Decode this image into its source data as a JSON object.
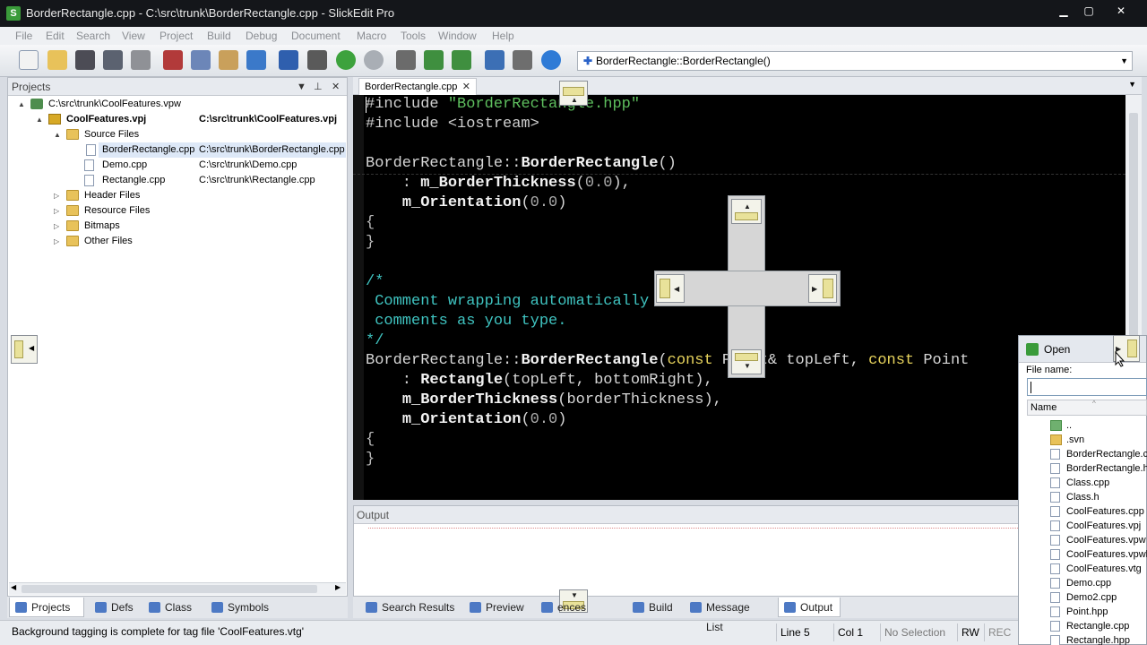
{
  "window": {
    "title": "BorderRectangle.cpp - C:\\src\\trunk\\BorderRectangle.cpp - SlickEdit Pro",
    "app_icon": "slickedit-icon",
    "controls": [
      "minimize",
      "maximize",
      "close"
    ]
  },
  "menu": [
    "File",
    "Edit",
    "Search",
    "View",
    "Project",
    "Build",
    "Debug",
    "Document",
    "Macro",
    "Tools",
    "Window",
    "Help"
  ],
  "toolbar": {
    "buttons": [
      "new",
      "open",
      "save",
      "save-all",
      "print",
      "cut",
      "copy",
      "paste",
      "select",
      "undo",
      "redo",
      "back",
      "forward",
      "find",
      "find-next",
      "find-in-files",
      "project",
      "options",
      "help"
    ],
    "symbol_combo": "BorderRectangle::BorderRectangle()"
  },
  "projects_panel": {
    "title": "Projects",
    "tree": [
      {
        "label": "C:\\src\\trunk\\CoolFeatures.vpw",
        "path": "",
        "level": 0,
        "icon": "workspace",
        "expander": "▲"
      },
      {
        "label": "CoolFeatures.vpj",
        "path": "C:\\src\\trunk\\CoolFeatures.vpj",
        "level": 1,
        "icon": "project",
        "expander": "▲",
        "bold": true
      },
      {
        "label": "Source Files",
        "path": "",
        "level": 2,
        "icon": "folder",
        "expander": "▲"
      },
      {
        "label": "BorderRectangle.cpp",
        "path": "C:\\src\\trunk\\BorderRectangle.cpp",
        "level": 3,
        "icon": "file",
        "expander": "",
        "selected": true
      },
      {
        "label": "Demo.cpp",
        "path": "C:\\src\\trunk\\Demo.cpp",
        "level": 3,
        "icon": "file",
        "expander": ""
      },
      {
        "label": "Rectangle.cpp",
        "path": "C:\\src\\trunk\\Rectangle.cpp",
        "level": 3,
        "icon": "file",
        "expander": ""
      },
      {
        "label": "Header Files",
        "path": "",
        "level": 2,
        "icon": "folder",
        "expander": "▷"
      },
      {
        "label": "Resource Files",
        "path": "",
        "level": 2,
        "icon": "folder",
        "expander": "▷"
      },
      {
        "label": "Bitmaps",
        "path": "",
        "level": 2,
        "icon": "folder",
        "expander": "▷"
      },
      {
        "label": "Other Files",
        "path": "",
        "level": 2,
        "icon": "folder",
        "expander": "▷"
      }
    ],
    "tabs": [
      "Projects",
      "Defs",
      "Class",
      "Symbols"
    ],
    "active_tab": "Projects"
  },
  "editor": {
    "tab": "BorderRectangle.cpp",
    "lines": [
      [
        {
          "t": "#include ",
          "c": "pp"
        },
        {
          "t": "\"BorderRectangle.hpp\"",
          "c": "str"
        }
      ],
      [
        {
          "t": "#include <iostream>",
          "c": "pp"
        }
      ],
      [],
      [
        {
          "t": "BorderRectangle",
          "c": ""
        },
        {
          "t": "::",
          "c": ""
        },
        {
          "t": "BorderRectangle",
          "c": "bold"
        },
        {
          "t": "()",
          "c": ""
        }
      ],
      [
        {
          "t": "    : ",
          "c": ""
        },
        {
          "t": "m_BorderThickness",
          "c": "bold"
        },
        {
          "t": "(",
          "c": ""
        },
        {
          "t": "0.0",
          "c": "num"
        },
        {
          "t": "),",
          "c": ""
        }
      ],
      [
        {
          "t": "    ",
          "c": ""
        },
        {
          "t": "m_Orientation",
          "c": "bold"
        },
        {
          "t": "(",
          "c": ""
        },
        {
          "t": "0.0",
          "c": "num"
        },
        {
          "t": ")",
          "c": ""
        }
      ],
      [
        {
          "t": "{",
          "c": "brace"
        }
      ],
      [
        {
          "t": "}",
          "c": "brace"
        }
      ],
      [],
      [
        {
          "t": "/*",
          "c": "cmt"
        }
      ],
      [
        {
          "t": " Comment wrapping automatically formats your",
          "c": "cmt"
        }
      ],
      [
        {
          "t": " comments as you type.",
          "c": "cmt"
        }
      ],
      [
        {
          "t": "*/",
          "c": "cmt"
        }
      ],
      [
        {
          "t": "BorderRectangle",
          "c": ""
        },
        {
          "t": "::",
          "c": ""
        },
        {
          "t": "BorderRectangle",
          "c": "bold"
        },
        {
          "t": "(",
          "c": ""
        },
        {
          "t": "const",
          "c": "kw"
        },
        {
          "t": " Point& topLeft, ",
          "c": ""
        },
        {
          "t": "const",
          "c": "kw"
        },
        {
          "t": " Point",
          "c": ""
        }
      ],
      [
        {
          "t": "    : ",
          "c": ""
        },
        {
          "t": "Rectangle",
          "c": "bold"
        },
        {
          "t": "(topLeft, bottomRight),",
          "c": ""
        }
      ],
      [
        {
          "t": "    ",
          "c": ""
        },
        {
          "t": "m_BorderThickness",
          "c": "bold"
        },
        {
          "t": "(borderThickness),",
          "c": ""
        }
      ],
      [
        {
          "t": "    ",
          "c": ""
        },
        {
          "t": "m_Orientation",
          "c": "bold"
        },
        {
          "t": "(",
          "c": ""
        },
        {
          "t": "0.0",
          "c": "num"
        },
        {
          "t": ")",
          "c": ""
        }
      ],
      [
        {
          "t": "{",
          "c": "brace"
        }
      ],
      [
        {
          "t": "}",
          "c": "brace"
        }
      ]
    ]
  },
  "output_panel": {
    "title": "Output",
    "tabs": [
      "Search Results",
      "Preview",
      "References",
      "Build",
      "Message List",
      "Output"
    ],
    "visible_tab_text": [
      "Search Results",
      "Preview",
      "ences",
      "Build",
      "Message List",
      "Output"
    ],
    "active_tab": "Output"
  },
  "status_bar": {
    "message": "Background tagging is complete for tag file 'CoolFeatures.vtg'",
    "line": "Line 5",
    "col": "Col 1",
    "selection": "No Selection",
    "mode": "RW",
    "rec": "REC"
  },
  "open_panel": {
    "title": "Open",
    "file_name_label": "File name:",
    "file_name_value": "",
    "column_header": "Name",
    "files": [
      {
        "name": "..",
        "type": "up"
      },
      {
        "name": ".svn",
        "type": "dir"
      },
      {
        "name": "BorderRectangle.c",
        "type": "file"
      },
      {
        "name": "BorderRectangle.h",
        "type": "file"
      },
      {
        "name": "Class.cpp",
        "type": "file"
      },
      {
        "name": "Class.h",
        "type": "file"
      },
      {
        "name": "CoolFeatures.cpp",
        "type": "file"
      },
      {
        "name": "CoolFeatures.vpj",
        "type": "file"
      },
      {
        "name": "CoolFeatures.vpw",
        "type": "file"
      },
      {
        "name": "CoolFeatures.vpwl",
        "type": "file"
      },
      {
        "name": "CoolFeatures.vtg",
        "type": "file"
      },
      {
        "name": "Demo.cpp",
        "type": "file"
      },
      {
        "name": "Demo2.cpp",
        "type": "file"
      },
      {
        "name": "Point.hpp",
        "type": "file"
      },
      {
        "name": "Rectangle.cpp",
        "type": "file"
      },
      {
        "name": "Rectangle.hpp",
        "type": "file"
      }
    ]
  },
  "colors": {
    "titlebar": "#14161a",
    "editor_bg": "#000000",
    "keyword": "#e7d35c",
    "string": "#5ebf5e",
    "comment": "#3fc3c0"
  }
}
